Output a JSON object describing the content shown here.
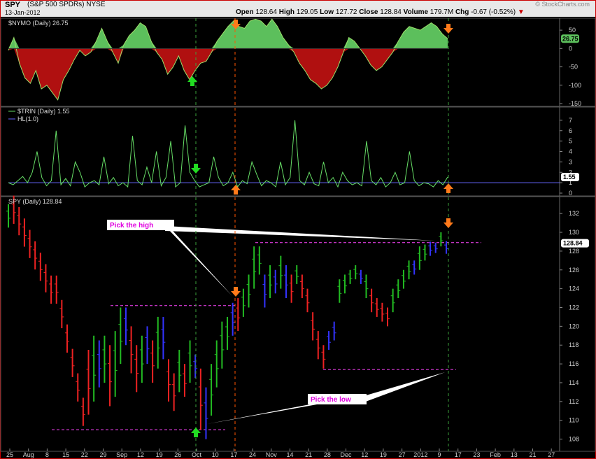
{
  "header": {
    "symbol": "SPY",
    "description": "(S&P 500 SPDRs) NYSE",
    "date": "13-Jan-2012",
    "quote_parts": [
      {
        "label": "Open",
        "value": "128.64"
      },
      {
        "label": "High",
        "value": "129.05"
      },
      {
        "label": "Low",
        "value": "127.72"
      },
      {
        "label": "Close",
        "value": "128.84"
      },
      {
        "label": "Volume",
        "value": "179.7M"
      },
      {
        "label": "Chg",
        "value": "-0.67 (-0.52%)"
      }
    ],
    "watermark": "© StockCharts.com"
  },
  "colors": {
    "background": "#000000",
    "up_bar": "#22bb22",
    "down_bar": "#ee2222",
    "neutral_bar": "#3333ff",
    "nymo_pos": "#5cbf5c",
    "nymo_neg": "#b01010",
    "trin_line": "#66dd66",
    "hl_line": "#6666ff",
    "pink_line": "#ff44ff",
    "orange_arrow": "#ff7a1a",
    "green_arrow": "#22dd22"
  },
  "chart_data": [
    {
      "panel": "nymo",
      "type": "area",
      "label": "$NYMO (Daily) 26.75",
      "last_value": "26.75",
      "ylim": [
        -150,
        75
      ],
      "y_ticks": [
        "50",
        "0",
        "-50",
        "-100",
        "-150"
      ],
      "y_tick_values": [
        50,
        0,
        -50,
        -100,
        -150
      ],
      "values": [
        -5,
        30,
        -40,
        -80,
        -95,
        -60,
        -110,
        -100,
        -120,
        -140,
        -85,
        -60,
        -30,
        -5,
        -20,
        -10,
        20,
        55,
        20,
        -10,
        -40,
        10,
        35,
        50,
        70,
        60,
        20,
        -10,
        -30,
        -70,
        -50,
        -20,
        -60,
        -85,
        -60,
        -40,
        -35,
        -10,
        20,
        40,
        60,
        75,
        60,
        55,
        75,
        80,
        75,
        60,
        80,
        60,
        30,
        10,
        -10,
        -40,
        -60,
        -85,
        -95,
        -110,
        -100,
        -80,
        -50,
        -10,
        30,
        20,
        0,
        -20,
        -45,
        -60,
        -50,
        -30,
        -10,
        20,
        45,
        60,
        55,
        50,
        60,
        70,
        60,
        40,
        26.75
      ]
    },
    {
      "panel": "trin",
      "type": "line",
      "label": "$TRIN (Daily) 1.55",
      "legend_hl": "HL(1.0)",
      "last_value": "1.55",
      "ylim": [
        0,
        8
      ],
      "y_ticks": [
        "7",
        "6",
        "5",
        "4",
        "3",
        "2",
        "1",
        "0"
      ],
      "y_tick_values": [
        7,
        6,
        5,
        4,
        3,
        2,
        1,
        0
      ],
      "hline": 1.0,
      "values": [
        1.0,
        0.8,
        1.2,
        1.6,
        1.0,
        2.0,
        4.0,
        1.5,
        0.7,
        1.2,
        6.0,
        0.8,
        1.4,
        0.7,
        3.0,
        2.0,
        0.6,
        1.0,
        1.2,
        0.8,
        3.5,
        0.9,
        1.5,
        0.7,
        1.0,
        0.6,
        5.5,
        1.2,
        0.8,
        2.5,
        1.0,
        4.0,
        0.7,
        1.5,
        5.0,
        0.6,
        1.0,
        6.5,
        2.0,
        1.2,
        0.6,
        0.8,
        1.0,
        3.5,
        1.5,
        0.7,
        1.0,
        2.0,
        0.6,
        1.2,
        0.9,
        3.0,
        1.8,
        0.7,
        1.2,
        1.0,
        0.6,
        3.0,
        0.8,
        1.5,
        7.0,
        1.2,
        0.8,
        2.0,
        0.9,
        0.7,
        3.0,
        1.0,
        1.5,
        0.6,
        2.0,
        1.2,
        0.8,
        1.0,
        0.7,
        5.0,
        1.2,
        0.8,
        1.5,
        0.6,
        1.0,
        2.0,
        0.8,
        1.0,
        4.0,
        1.2,
        0.7,
        1.0,
        0.9,
        0.6,
        1.2,
        0.8,
        1.55
      ]
    },
    {
      "panel": "price",
      "type": "bar",
      "label": "SPY (Daily) 128.84",
      "last_value": "128.84",
      "ylim": [
        107,
        133.5
      ],
      "y_ticks": [
        "132",
        "130",
        "128",
        "126",
        "124",
        "122",
        "120",
        "118",
        "116",
        "114",
        "112",
        "110",
        "108"
      ],
      "y_tick_values": [
        132,
        130,
        128,
        126,
        124,
        122,
        120,
        118,
        116,
        114,
        112,
        110,
        108
      ],
      "x_tick_labels": [
        "25",
        "Aug",
        "8",
        "15",
        "22",
        "29",
        "Sep",
        "12",
        "19",
        "26",
        "Oct",
        "10",
        "17",
        "24",
        "Nov",
        "14",
        "21",
        "28",
        "Dec",
        "12",
        "19",
        "27",
        "2012",
        "9",
        "17",
        "23",
        "Feb",
        "13",
        "21",
        "27"
      ],
      "resistance_lines": [
        122.2,
        128.9
      ],
      "support_lines": [
        109.0,
        115.4
      ],
      "annotations": [
        "Pick the high",
        "Pick the low"
      ],
      "ohlc_segments": [
        {
          "c": "green",
          "lo": 130.5,
          "hi": 133.0
        },
        {
          "c": "red",
          "trend": [
            132.5,
            124.0
          ],
          "n": 8
        },
        {
          "c": "red",
          "trend": [
            124.0,
            111.0
          ],
          "n": 6
        },
        {
          "c": "red",
          "lo": 110.6,
          "hi": 117.5
        },
        {
          "c": "green",
          "lo": 112.0,
          "hi": 119.0
        },
        {
          "c": "blue",
          "lo": 113.5,
          "hi": 118.5
        },
        {
          "c": "green",
          "lo": 114.0,
          "hi": 119.0
        },
        {
          "c": "red",
          "lo": 111.5,
          "hi": 118.0
        },
        {
          "c": "green",
          "lo": 112.5,
          "hi": 119.5
        },
        {
          "c": "green",
          "lo": 116.0,
          "hi": 122.0
        },
        {
          "c": "blue",
          "lo": 118.0,
          "hi": 122.0
        },
        {
          "c": "red",
          "lo": 115.0,
          "hi": 120.0
        },
        {
          "c": "red",
          "lo": 113.0,
          "hi": 118.0
        },
        {
          "c": "green",
          "lo": 114.0,
          "hi": 119.0
        },
        {
          "c": "blue",
          "lo": 116.0,
          "hi": 120.0
        },
        {
          "c": "red",
          "lo": 114.0,
          "hi": 118.5
        },
        {
          "c": "green",
          "lo": 115.5,
          "hi": 121.0
        },
        {
          "c": "blue",
          "lo": 116.5,
          "hi": 121.0
        },
        {
          "c": "red",
          "lo": 112.0,
          "hi": 116.5
        },
        {
          "c": "red",
          "lo": 111.0,
          "hi": 115.0
        },
        {
          "c": "green",
          "lo": 113.0,
          "hi": 117.5
        },
        {
          "c": "red",
          "lo": 112.5,
          "hi": 116.0
        },
        {
          "c": "green",
          "lo": 114.0,
          "hi": 118.5
        },
        {
          "c": "blue",
          "lo": 114.5,
          "hi": 117.0
        },
        {
          "c": "red",
          "lo": 109.0,
          "hi": 115.5
        },
        {
          "c": "blue",
          "lo": 108.0,
          "hi": 113.5
        },
        {
          "c": "green",
          "lo": 110.5,
          "hi": 116.0
        },
        {
          "c": "green",
          "lo": 113.5,
          "hi": 118.5
        },
        {
          "c": "green",
          "lo": 115.5,
          "hi": 120.5
        },
        {
          "c": "green",
          "lo": 117.5,
          "hi": 121.0
        },
        {
          "c": "blue",
          "lo": 119.0,
          "hi": 122.5
        },
        {
          "c": "red",
          "lo": 119.5,
          "hi": 123.0
        },
        {
          "c": "green",
          "lo": 121.0,
          "hi": 124.0
        },
        {
          "c": "green",
          "lo": 122.0,
          "hi": 125.5
        },
        {
          "c": "green",
          "lo": 124.0,
          "hi": 128.5
        },
        {
          "c": "green",
          "lo": 125.5,
          "hi": 128.5
        },
        {
          "c": "blue",
          "lo": 122.0,
          "hi": 125.5
        },
        {
          "c": "green",
          "lo": 123.0,
          "hi": 126.5
        },
        {
          "c": "blue",
          "lo": 123.5,
          "hi": 126.0
        },
        {
          "c": "green",
          "lo": 124.0,
          "hi": 127.5
        },
        {
          "c": "blue",
          "lo": 123.0,
          "hi": 126.5
        },
        {
          "c": "red",
          "lo": 122.5,
          "hi": 125.5
        },
        {
          "c": "green",
          "lo": 124.5,
          "hi": 126.5
        },
        {
          "c": "red",
          "lo": 123.0,
          "hi": 125.5
        },
        {
          "c": "red",
          "lo": 121.5,
          "hi": 124.0
        },
        {
          "c": "red",
          "lo": 118.5,
          "hi": 121.5
        },
        {
          "c": "red",
          "lo": 116.5,
          "hi": 119.5
        },
        {
          "c": "red",
          "lo": 115.5,
          "hi": 118.0
        },
        {
          "c": "blue",
          "lo": 117.5,
          "hi": 119.5
        },
        {
          "c": "blue",
          "lo": 118.5,
          "hi": 120.5
        },
        {
          "c": "green",
          "lo": 122.5,
          "hi": 125.0
        },
        {
          "c": "green",
          "lo": 123.5,
          "hi": 125.5
        },
        {
          "c": "green",
          "lo": 124.5,
          "hi": 126.0
        },
        {
          "c": "green",
          "lo": 125.0,
          "hi": 126.5
        },
        {
          "c": "blue",
          "lo": 124.5,
          "hi": 126.0
        },
        {
          "c": "green",
          "lo": 123.0,
          "hi": 125.5
        },
        {
          "c": "red",
          "lo": 121.5,
          "hi": 124.0
        },
        {
          "c": "red",
          "lo": 121.0,
          "hi": 123.0
        },
        {
          "c": "red",
          "lo": 120.5,
          "hi": 122.5
        },
        {
          "c": "red",
          "lo": 120.0,
          "hi": 122.0
        },
        {
          "c": "green",
          "lo": 121.5,
          "hi": 124.0
        },
        {
          "c": "green",
          "lo": 123.0,
          "hi": 125.0
        },
        {
          "c": "green",
          "lo": 124.0,
          "hi": 126.0
        },
        {
          "c": "green",
          "lo": 125.0,
          "hi": 127.0
        },
        {
          "c": "blue",
          "lo": 125.5,
          "hi": 127.0
        },
        {
          "c": "green",
          "lo": 126.0,
          "hi": 128.5
        },
        {
          "c": "green",
          "lo": 127.0,
          "hi": 128.7
        },
        {
          "c": "blue",
          "lo": 127.5,
          "hi": 129.0
        },
        {
          "c": "blue",
          "lo": 127.8,
          "hi": 128.9
        },
        {
          "c": "green",
          "lo": 128.5,
          "hi": 130.0
        },
        {
          "c": "blue",
          "lo": 127.72,
          "hi": 129.05
        }
      ]
    }
  ]
}
